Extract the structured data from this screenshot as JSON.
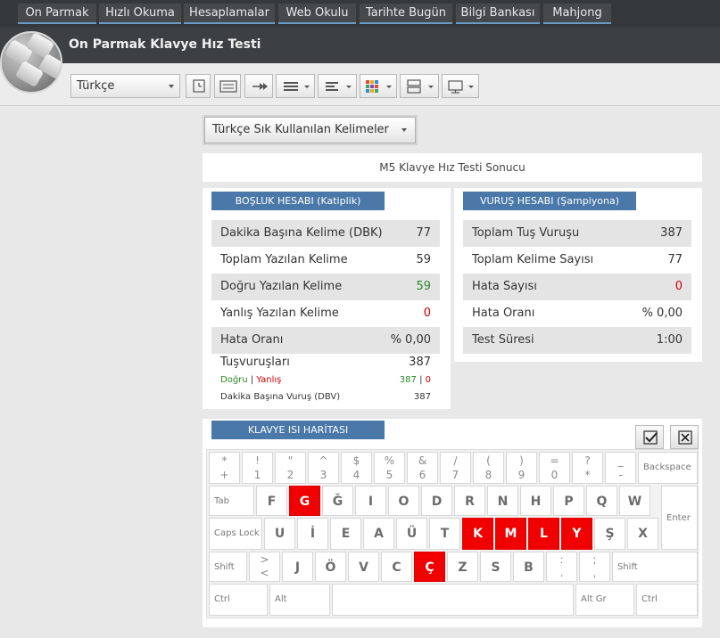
{
  "nav": [
    "On Parmak",
    "Hızlı Okuma",
    "Hesaplamalar",
    "Web Okulu",
    "Tarihte Bugün",
    "Bilgi Bankası",
    "Mahjong"
  ],
  "page_title": "On Parmak Klavye Hız Testi",
  "language_select": "Türkçe",
  "category_select": "Türkçe Sık Kullanılan Kelimeler",
  "result_title": "M5 Klavye Hız Testi Sonucu",
  "bosluk": {
    "title": "BOŞLUK HESABI (Katiplik)",
    "rows": [
      {
        "label": "Dakika Başına Kelime (DBK)",
        "value": "77"
      },
      {
        "label": "Toplam Yazılan Kelime",
        "value": "59"
      },
      {
        "label": "Doğru Yazılan Kelime",
        "value": "59"
      },
      {
        "label": "Yanlış Yazılan Kelime",
        "value": "0"
      },
      {
        "label": "Hata Oranı",
        "value": "% 0,00"
      }
    ],
    "tus_label": "Tuşvuruşları",
    "tus_value": "387",
    "dogru_label": "Doğru",
    "sep": "|",
    "yanlis_label": "Yanlış",
    "dogru_value": "387",
    "yanlis_value": "0",
    "dbv_label": "Dakika Başına Vuruş (DBV)",
    "dbv_value": "387"
  },
  "vurus": {
    "title": "VURUŞ HESABI (Şampiyona)",
    "rows": [
      {
        "label": "Toplam Tuş Vuruşu",
        "value": "387"
      },
      {
        "label": "Toplam Kelime Sayısı",
        "value": "77"
      },
      {
        "label": "Hata Sayısı",
        "value": "0"
      },
      {
        "label": "Hata Oranı",
        "value": "% 0,00"
      },
      {
        "label": "Test Süresi",
        "value": "1:00"
      }
    ]
  },
  "keyboard": {
    "title": "KLAVYE ISI HARİTASI",
    "number_row": [
      {
        "top": "*",
        "bottom": "+"
      },
      {
        "top": "!",
        "bottom": "1"
      },
      {
        "top": "\"",
        "bottom": "2"
      },
      {
        "top": "^",
        "bottom": "3"
      },
      {
        "top": "$",
        "bottom": "4"
      },
      {
        "top": "%",
        "bottom": "5"
      },
      {
        "top": "&",
        "bottom": "6"
      },
      {
        "top": "/",
        "bottom": "7"
      },
      {
        "top": "(",
        "bottom": "8"
      },
      {
        "top": ")",
        "bottom": "9"
      },
      {
        "top": "=",
        "bottom": "0"
      },
      {
        "top": "?",
        "bottom": "*"
      },
      {
        "top": "_",
        "bottom": "-"
      }
    ],
    "backspace": "Backspace",
    "tab": "Tab",
    "row_q": [
      "F",
      "G",
      "Ğ",
      "I",
      "O",
      "D",
      "R",
      "N",
      "H",
      "P",
      "Q",
      "W"
    ],
    "enter": "Enter",
    "caps": "Caps Lock",
    "row_a": [
      "U",
      "İ",
      "E",
      "A",
      "Ü",
      "T",
      "K",
      "M",
      "L",
      "Y",
      "Ş",
      "X"
    ],
    "shift_left": "Shift",
    "angle_key": {
      "top": ">",
      "bottom": "<"
    },
    "row_z": [
      "J",
      "Ö",
      "V",
      "C",
      "Ç",
      "Z",
      "S",
      "B"
    ],
    "colon_key": {
      "top": ":",
      "bottom": "."
    },
    "semicolon_key": {
      "top": ";",
      "bottom": ","
    },
    "shift_right": "Shift",
    "ctrl_left": "Ctrl",
    "alt": "Alt",
    "altgr": "Alt Gr",
    "ctrl_right": "Ctrl",
    "hot_keys": [
      "G",
      "K",
      "M",
      "L",
      "Y",
      "Ç"
    ],
    "heat_color": "#f00000"
  },
  "icons": [
    "clock-icon",
    "keyboard-icon",
    "arrows-icon",
    "lines-icon",
    "align-icon",
    "color-grid-icon",
    "layout-icon",
    "monitor-icon",
    "check-icon",
    "close-icon"
  ]
}
